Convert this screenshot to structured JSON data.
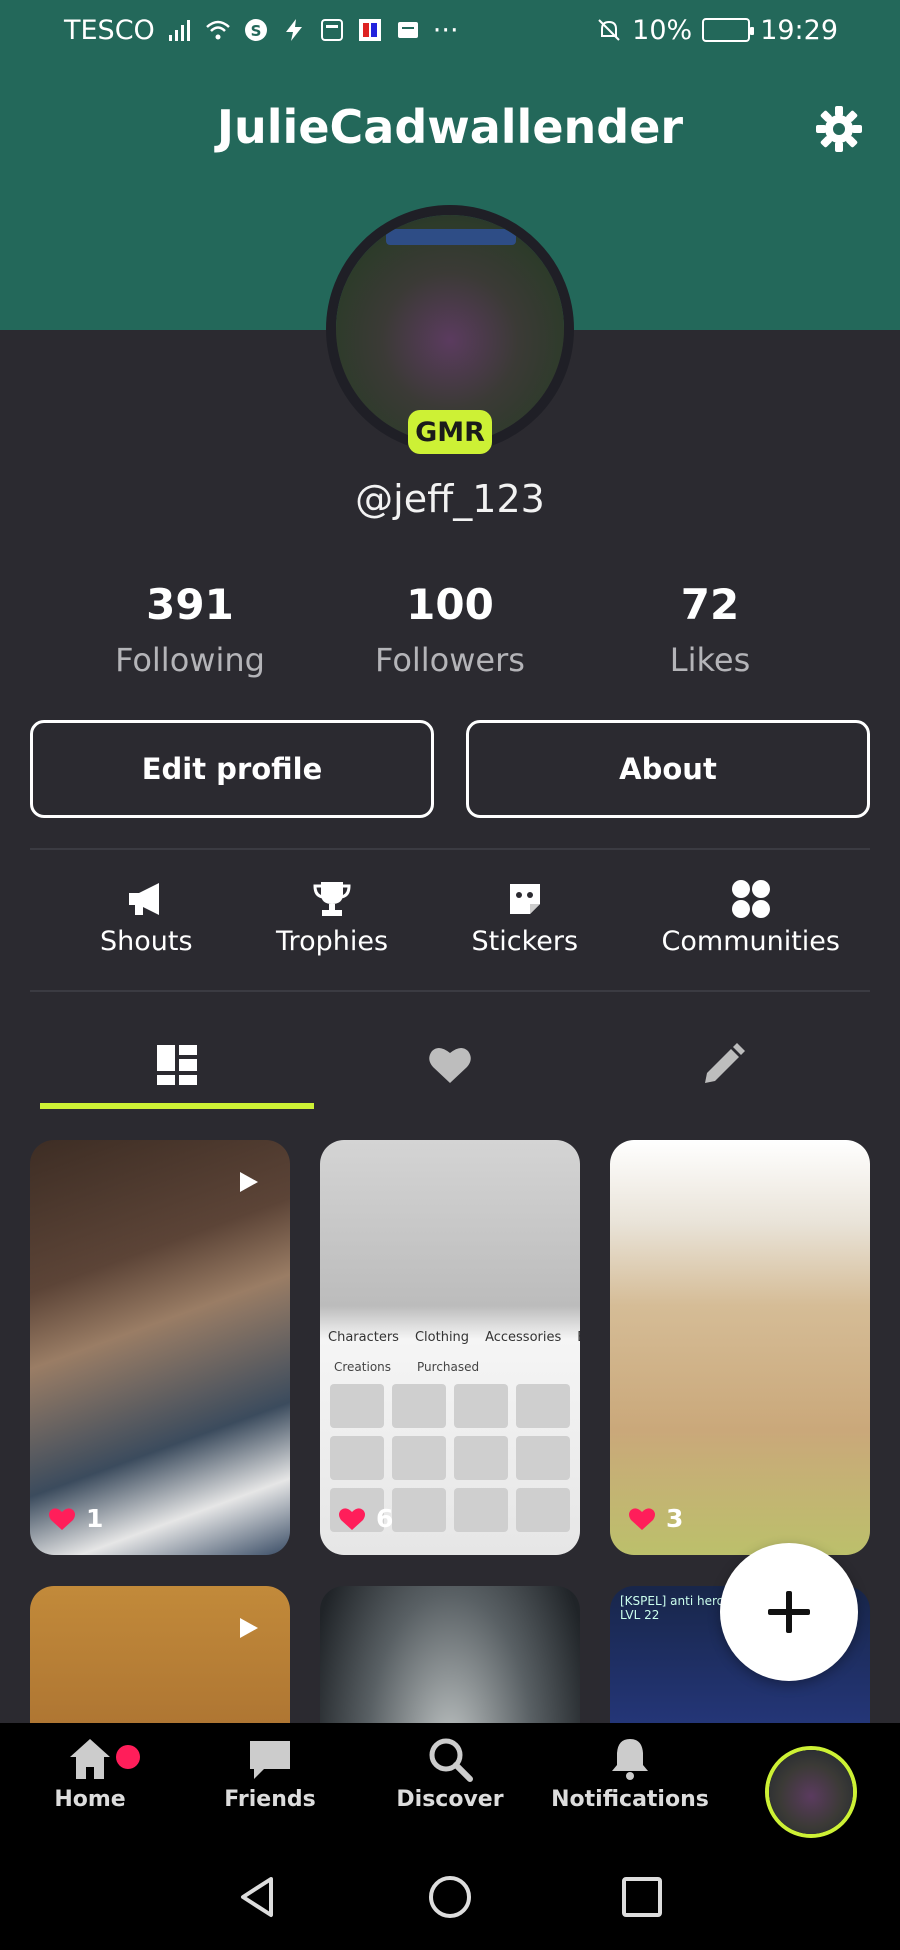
{
  "status_bar": {
    "carrier": "TESCO",
    "more": "···",
    "battery": "10%",
    "time": "19:29"
  },
  "header": {
    "title": "JulieCadwallender",
    "background_color": "#23685a"
  },
  "profile": {
    "badge": "GMR",
    "handle": "@jeff_123",
    "stats": [
      {
        "value": "391",
        "label": "Following"
      },
      {
        "value": "100",
        "label": "Followers"
      },
      {
        "value": "72",
        "label": "Likes"
      }
    ],
    "buttons": {
      "edit": "Edit profile",
      "about": "About"
    }
  },
  "features": [
    {
      "label": "Shouts",
      "icon": "megaphone-icon"
    },
    {
      "label": "Trophies",
      "icon": "trophy-icon"
    },
    {
      "label": "Stickers",
      "icon": "sticker-icon"
    },
    {
      "label": "Communities",
      "icon": "grid-dots-icon"
    }
  ],
  "content_tabs": [
    {
      "icon": "posts-grid-icon",
      "active": true
    },
    {
      "icon": "heart-icon",
      "active": false
    },
    {
      "icon": "pencil-icon",
      "active": false
    }
  ],
  "posts": [
    {
      "likes": "1",
      "video": true
    },
    {
      "likes": "6",
      "video": false,
      "tabs": [
        "Characters",
        "Clothing",
        "Accessories",
        "E"
      ],
      "subtabs": [
        "Creations",
        "Purchased"
      ]
    },
    {
      "likes": "3",
      "video": false
    },
    {
      "video": true
    },
    {
      "video": false
    },
    {
      "video": false,
      "overlay_line1": "[KSPEL] anti hero",
      "overlay_line2": "LVL 22"
    }
  ],
  "bottom_nav": [
    {
      "label": "Home",
      "icon": "home-icon",
      "has_notification_dot": true
    },
    {
      "label": "Friends",
      "icon": "chat-bubble-icon"
    },
    {
      "label": "Discover",
      "icon": "search-icon"
    },
    {
      "label": "Notifications",
      "icon": "bell-icon"
    }
  ],
  "accent_color": "#cdf135",
  "like_color": "#ff1e5a"
}
